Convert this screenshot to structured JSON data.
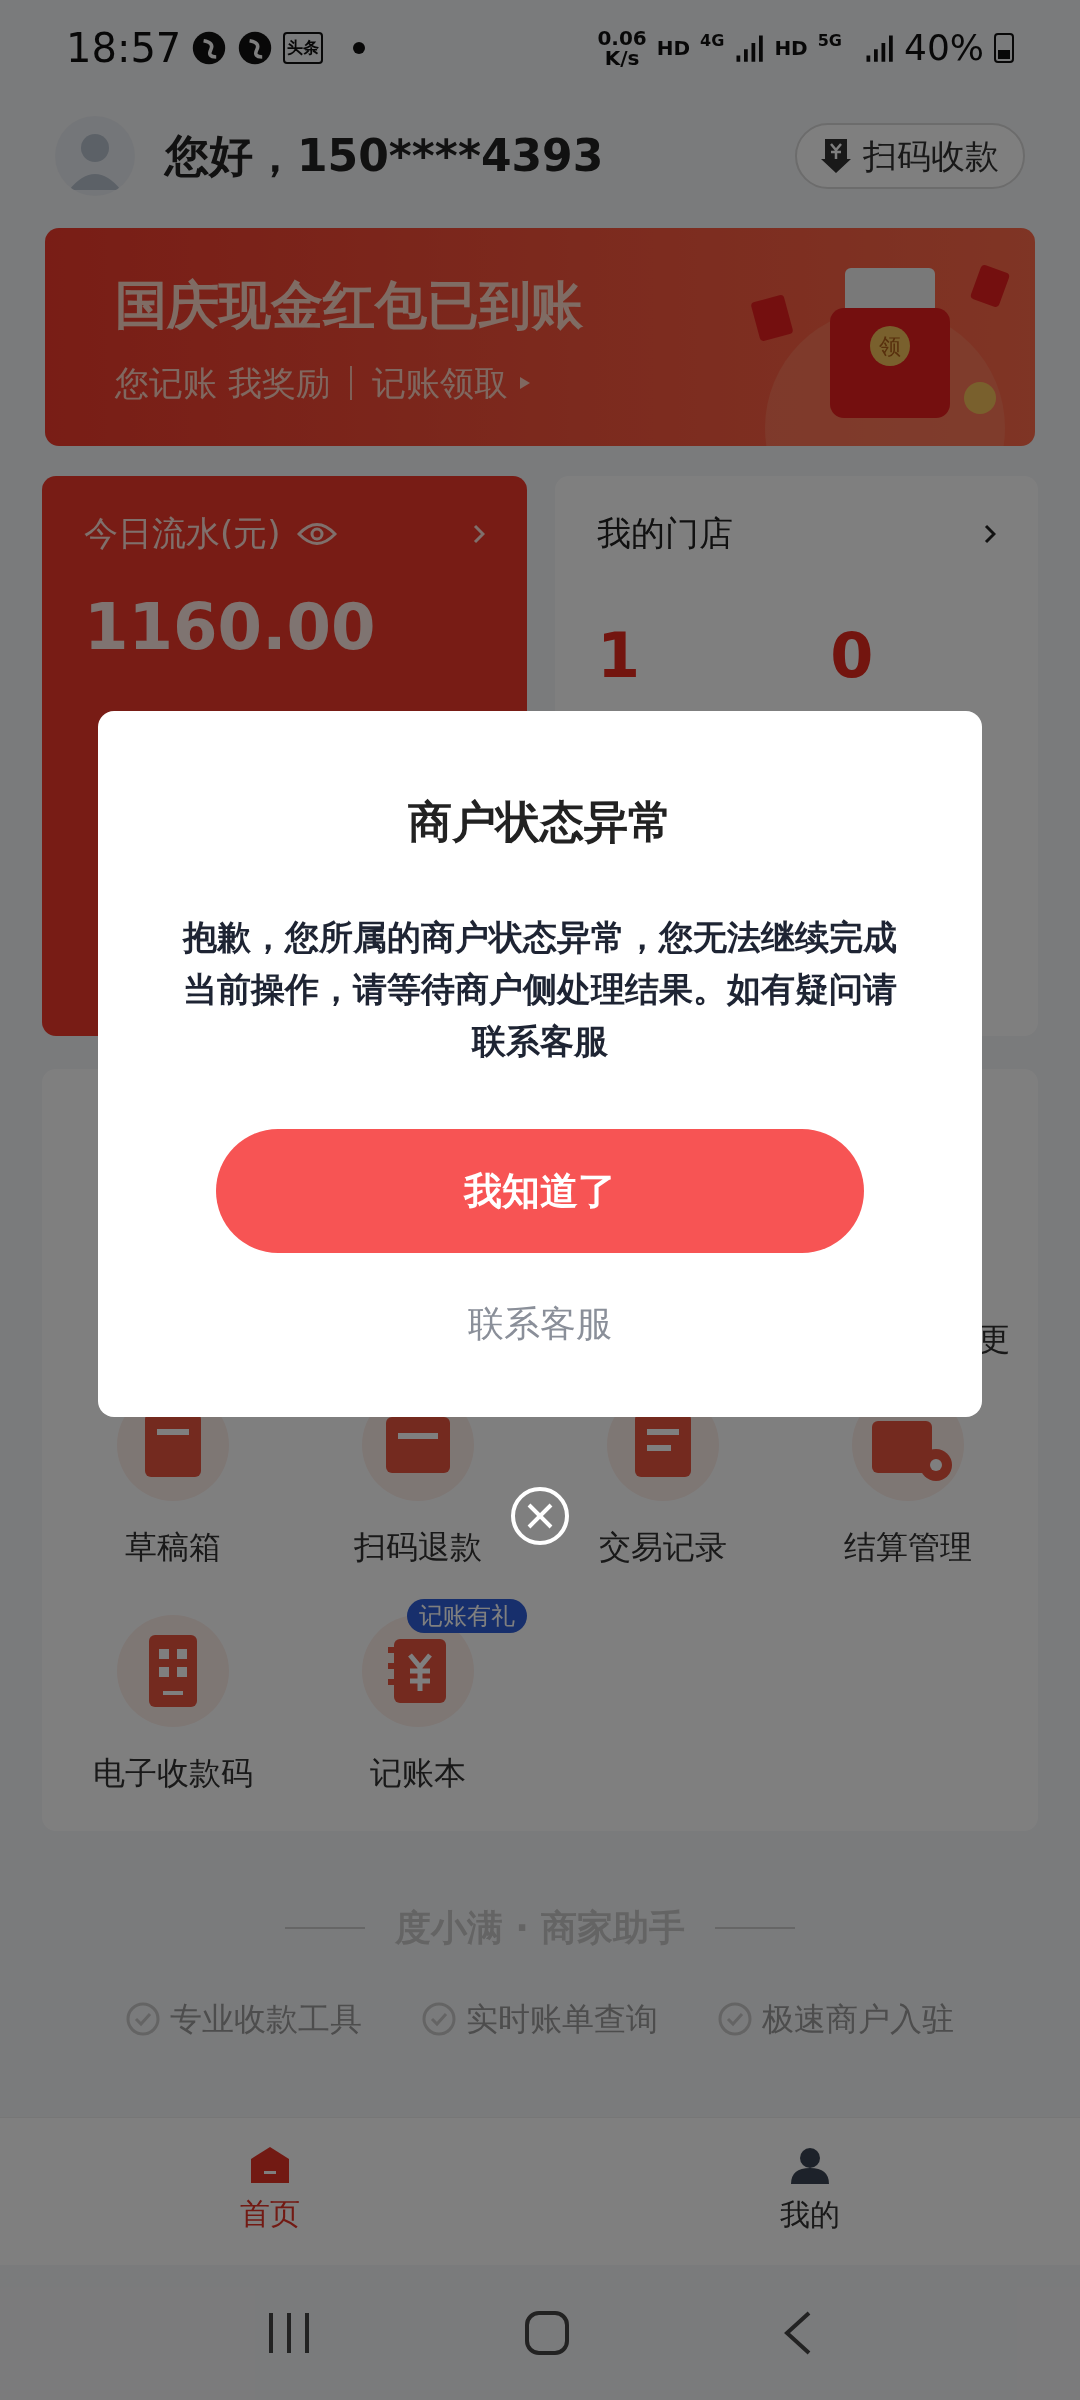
{
  "status_bar": {
    "time": "18:57",
    "app_badge": "头条",
    "net_speed": "0.06",
    "net_unit": "K/s",
    "sim1_hd": "HD",
    "sim1_type": "4G",
    "sim2_hd": "HD",
    "sim2_type": "5G",
    "battery": "40%"
  },
  "header": {
    "greeting": "您好，150****4393",
    "scan_button": "扫码收款"
  },
  "banner": {
    "title": "国庆现金红包已到账",
    "subtitle": "您记账 我奖励",
    "link": "记账领取",
    "coin_label": "领"
  },
  "flow_card": {
    "title": "今日流水(元)",
    "amount": "1160.00"
  },
  "store_card": {
    "title": "我的门店",
    "counts": [
      "1",
      "0"
    ]
  },
  "tools": {
    "more_fragment": "更",
    "items": [
      {
        "label": "草稿箱",
        "kind": "draft"
      },
      {
        "label": "扫码退款",
        "kind": "refund"
      },
      {
        "label": "交易记录",
        "kind": "record"
      },
      {
        "label": "结算管理",
        "kind": "settle"
      },
      {
        "label": "电子收款码",
        "kind": "qrcode"
      },
      {
        "label": "记账本",
        "kind": "ledger",
        "badge": "记账有礼"
      }
    ]
  },
  "footer": {
    "brand": "度小满 · 商家助手",
    "features": [
      "专业收款工具",
      "实时账单查询",
      "极速商户入驻"
    ]
  },
  "bottom_nav": [
    {
      "label": "首页",
      "kind": "home",
      "selected": true
    },
    {
      "label": "我的",
      "kind": "person",
      "selected": false
    }
  ],
  "modal": {
    "title": "商户状态异常",
    "message": "抱歉，您所属的商户状态异常，您无法继续完成当前操作，请等待商户侧处理结果。如有疑问请联系客服",
    "primary_button": "我知道了",
    "secondary_link": "联系客服"
  }
}
